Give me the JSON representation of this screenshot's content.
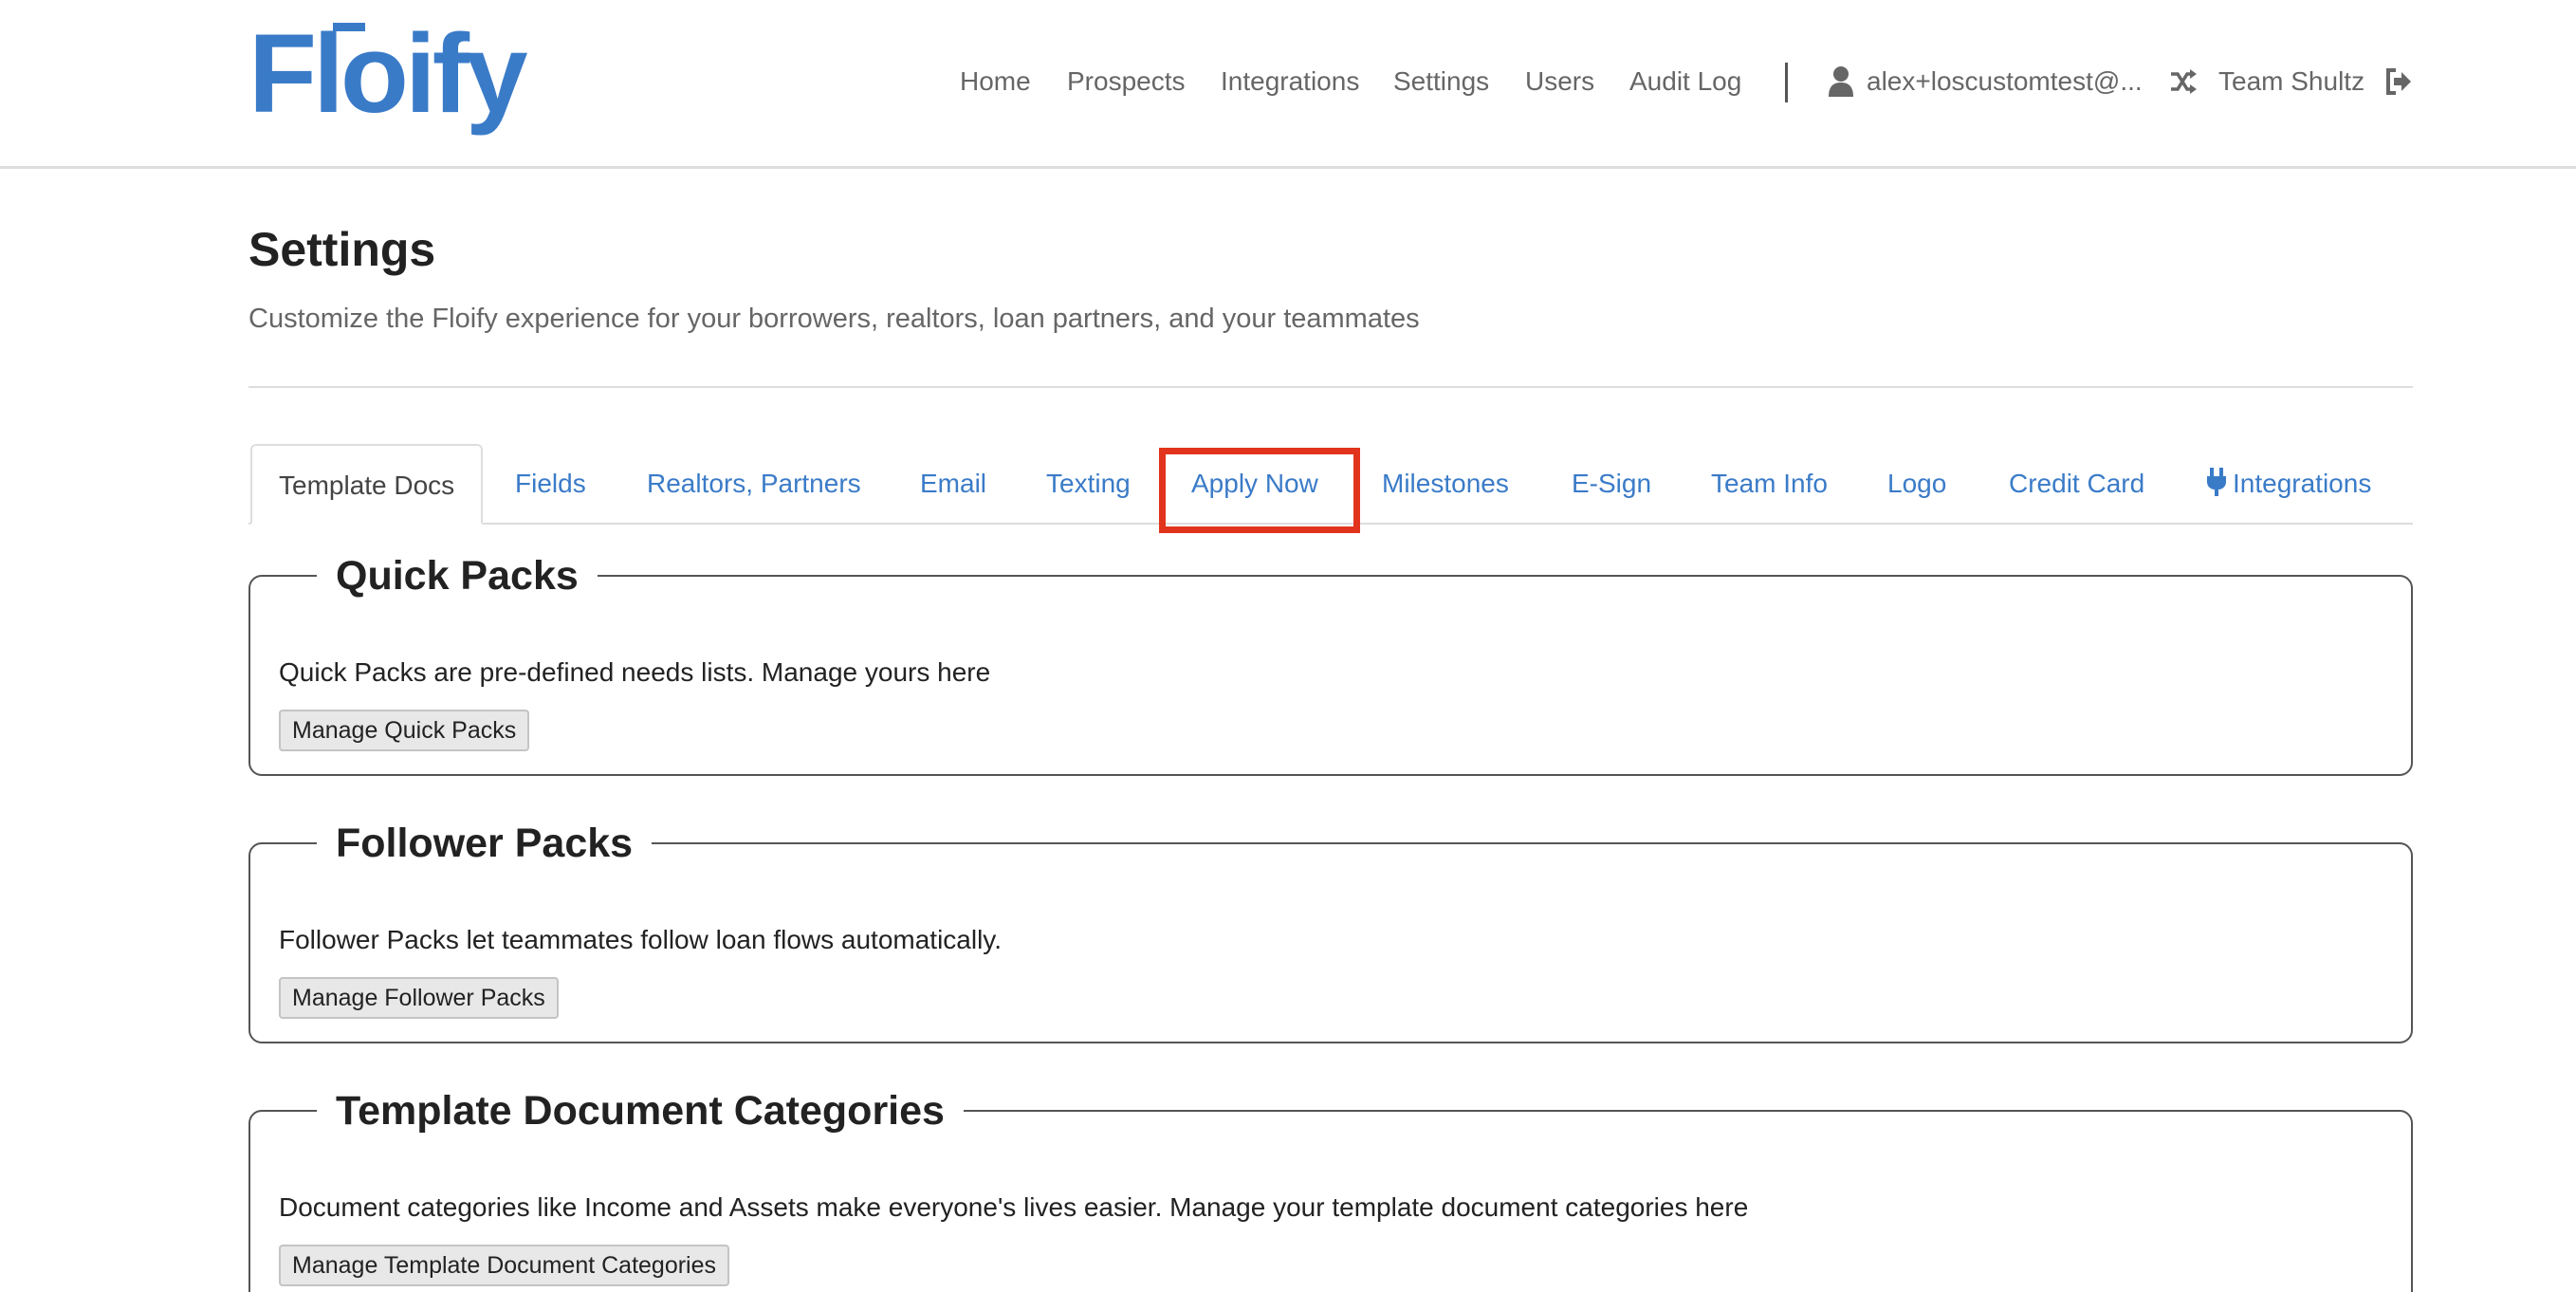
{
  "brand": {
    "name": "Floify",
    "color": "#3a7bc8"
  },
  "nav": {
    "home": "Home",
    "prospects": "Prospects",
    "integrations": "Integrations",
    "settings": "Settings",
    "users": "Users",
    "audit_log": "Audit Log",
    "user_email": "alex+loscustomtest@...",
    "team": "Team Shultz",
    "icons": {
      "user": "user-icon",
      "switch_team": "shuffle-icon",
      "logout": "sign-out-icon"
    }
  },
  "page": {
    "title": "Settings",
    "subtitle": "Customize the Floify experience for your borrowers, realtors, loan partners, and your teammates"
  },
  "tabs": [
    {
      "label": "Template Docs",
      "active": true
    },
    {
      "label": "Fields"
    },
    {
      "label": "Realtors, Partners"
    },
    {
      "label": "Email"
    },
    {
      "label": "Texting"
    },
    {
      "label": "Apply Now",
      "highlighted": true
    },
    {
      "label": "Milestones"
    },
    {
      "label": "E-Sign"
    },
    {
      "label": "Team Info"
    },
    {
      "label": "Logo"
    },
    {
      "label": "Credit Card"
    },
    {
      "label": "Integrations",
      "icon": "plug-icon"
    }
  ],
  "sections": {
    "quick_packs": {
      "title": "Quick Packs",
      "description": "Quick Packs are pre-defined needs lists. Manage yours here",
      "button": "Manage Quick Packs"
    },
    "follower_packs": {
      "title": "Follower Packs",
      "description": "Follower Packs let teammates follow loan flows automatically.",
      "button": "Manage Follower Packs"
    },
    "template_categories": {
      "title": "Template Document Categories",
      "description": "Document categories like Income and Assets make everyone's lives easier. Manage your template document categories here",
      "button": "Manage Template Document Categories"
    }
  },
  "colors": {
    "link": "#3a7bc8",
    "highlight_border": "#e2341d",
    "nav_text": "#666666"
  }
}
